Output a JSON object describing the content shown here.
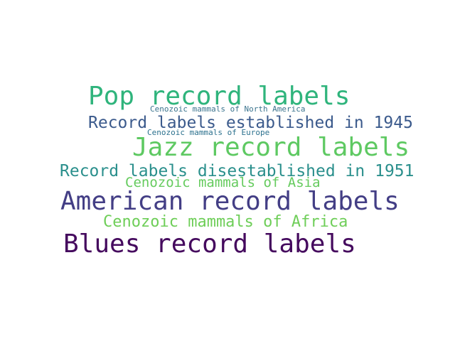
{
  "words": [
    {
      "text": "Pop record labels",
      "color": "#2fb47c"
    },
    {
      "text": "Cenozoic mammals of North America",
      "color": "#3b748e"
    },
    {
      "text": "Record labels established in 1945",
      "color": "#3b5a8c"
    },
    {
      "text": "Cenozoic mammals of Europe",
      "color": "#2c718e"
    },
    {
      "text": "Jazz record labels",
      "color": "#5ec962"
    },
    {
      "text": "Record labels disestablished in 1951",
      "color": "#2a8f8c"
    },
    {
      "text": "Cenozoic mammals of Asia",
      "color": "#65cb5e"
    },
    {
      "text": "American record labels",
      "color": "#433e85"
    },
    {
      "text": "Cenozoic mammals of Africa",
      "color": "#6ece58"
    },
    {
      "text": "Blues record labels",
      "color": "#450a5e"
    }
  ]
}
